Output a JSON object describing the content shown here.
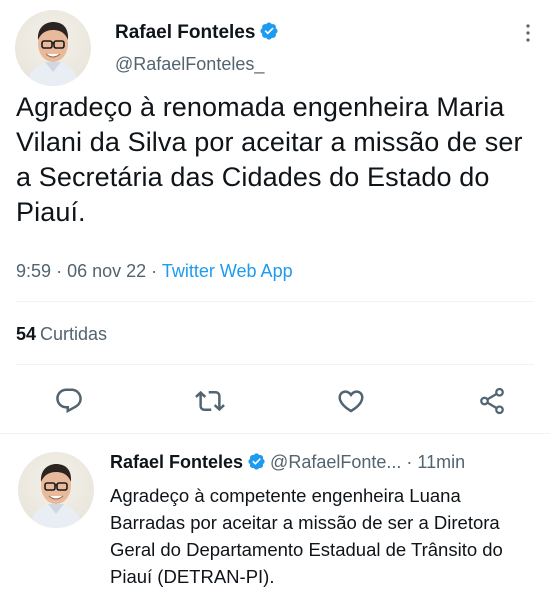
{
  "tweet": {
    "author_name": "Rafael Fonteles",
    "author_handle": "@RafaelFonteles_",
    "text": "Agradeço à renomada engenheira Maria Vilani da Silva por aceitar a missão de ser a Secretária das Cidades do Estado do Piauí.",
    "time": "9:59",
    "date": "06 nov 22",
    "separator": "·",
    "app": "Twitter Web App",
    "likes_count": "54",
    "likes_label": "Curtidas"
  },
  "reply": {
    "author_name": "Rafael Fonteles",
    "author_handle": "@RafaelFonte...",
    "separator": "·",
    "time": "11min",
    "text": "Agradeço à competente engenheira Luana Barradas por aceitar a missão de ser a Diretora Geral do Departamento Estadual de Trânsito do Piauí (DETRAN-PI)."
  },
  "icons": {
    "verified": "verified-badge-icon",
    "more": "more-options-icon",
    "reply": "reply-icon",
    "retweet": "retweet-icon",
    "like": "like-icon",
    "share": "share-icon"
  },
  "colors": {
    "accent": "#1d9bf0",
    "text": "#0f1419",
    "secondary": "#536471",
    "divider": "#eff3f4"
  }
}
